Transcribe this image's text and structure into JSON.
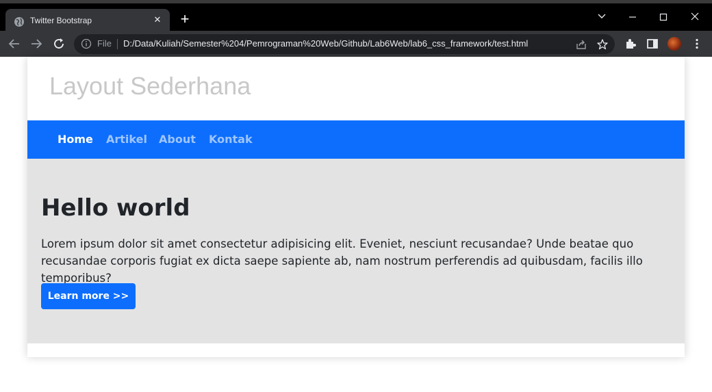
{
  "browser": {
    "tab_title": "Twitter Bootstrap",
    "url_scheme": "File",
    "url": "D:/Data/Kuliah/Semester%204/Pemrograman%20Web/Github/Lab6Web/lab6_css_framework/test.html"
  },
  "page": {
    "site_title": "Layout Sederhana",
    "nav": [
      {
        "label": "Home",
        "active": true
      },
      {
        "label": "Artikel",
        "active": false
      },
      {
        "label": "About",
        "active": false
      },
      {
        "label": "Kontak",
        "active": false
      }
    ],
    "hero": {
      "title": "Hello world",
      "text": "Lorem ipsum dolor sit amet consectetur adipisicing elit. Eveniet, nesciunt recusandae? Unde beatae quo recusandae corporis fugiat ex dicta saepe sapiente ab, nam nostrum perferendis ad quibusdam, facilis illo temporibus?",
      "button_label": "Learn more >>"
    }
  },
  "colors": {
    "primary": "#0d6efd",
    "hero_bg": "#e3e3e4",
    "title_gray": "#c8c8c8"
  }
}
